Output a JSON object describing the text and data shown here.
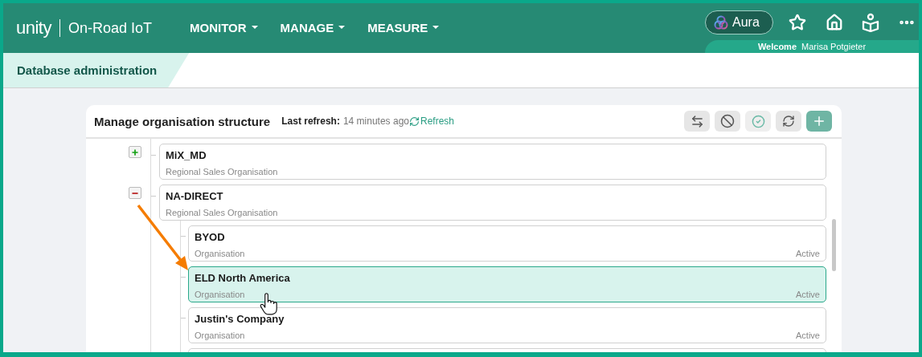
{
  "header": {
    "logo": "unity",
    "product": "On-Road IoT",
    "menus": [
      {
        "label": "MONITOR"
      },
      {
        "label": "MANAGE"
      },
      {
        "label": "MEASURE"
      }
    ],
    "aura": "Aura",
    "welcome_label": "Welcome",
    "user": "Marisa Potgieter"
  },
  "breadcrumb": "Database administration",
  "panel": {
    "title": "Manage organisation structure",
    "refresh_label": "Last refresh:",
    "refresh_age": "14 minutes ago",
    "refresh_link": "Refresh",
    "tools": [
      {
        "kind": "swap"
      },
      {
        "kind": "block"
      },
      {
        "kind": "check"
      },
      {
        "kind": "sync"
      },
      {
        "kind": "add"
      }
    ],
    "tree": [
      {
        "name": "MiX_MD",
        "type": "Regional Sales Organisation",
        "expanded": false,
        "selected": false
      },
      {
        "name": "NA-DIRECT",
        "type": "Regional Sales Organisation",
        "expanded": true,
        "selected": false,
        "children": [
          {
            "name": "BYOD",
            "type": "Organisation",
            "status": "Active",
            "selected": false
          },
          {
            "name": "ELD North America",
            "type": "Organisation",
            "status": "Active",
            "selected": true
          },
          {
            "name": "Justin's Company",
            "type": "Organisation",
            "status": "Active",
            "selected": false
          },
          {
            "selected": false
          }
        ]
      }
    ]
  }
}
